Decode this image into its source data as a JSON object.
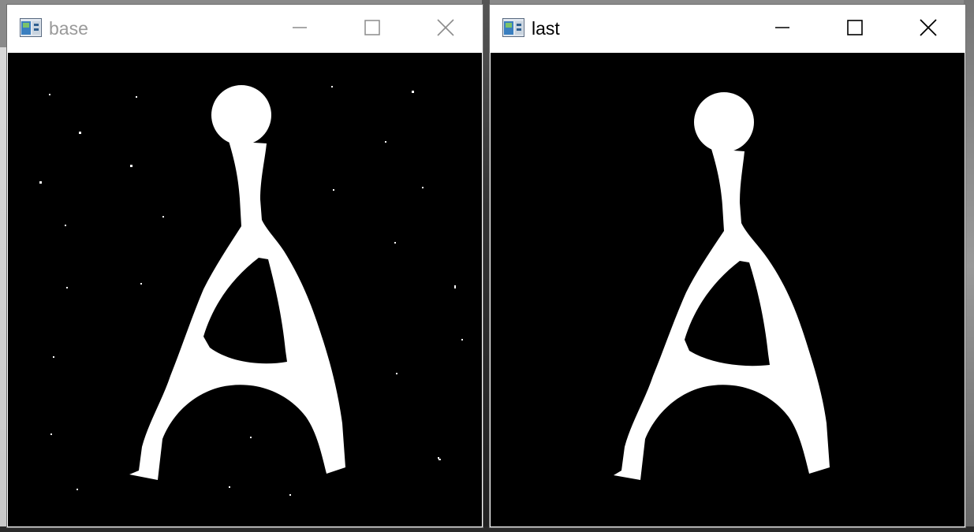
{
  "windows": [
    {
      "title": "base",
      "active": false,
      "image_name": "base-image",
      "noise_specks": true
    },
    {
      "title": "last",
      "active": true,
      "image_name": "last-image",
      "noise_specks": false
    }
  ],
  "controls": {
    "minimize_icon": "minimize-icon",
    "maximize_icon": "maximize-icon",
    "close_icon": "close-icon"
  },
  "colors": {
    "image_bg": "#000000",
    "shape": "#ffffff",
    "inactive_title": "#9a9a9a",
    "active_title": "#000000"
  }
}
